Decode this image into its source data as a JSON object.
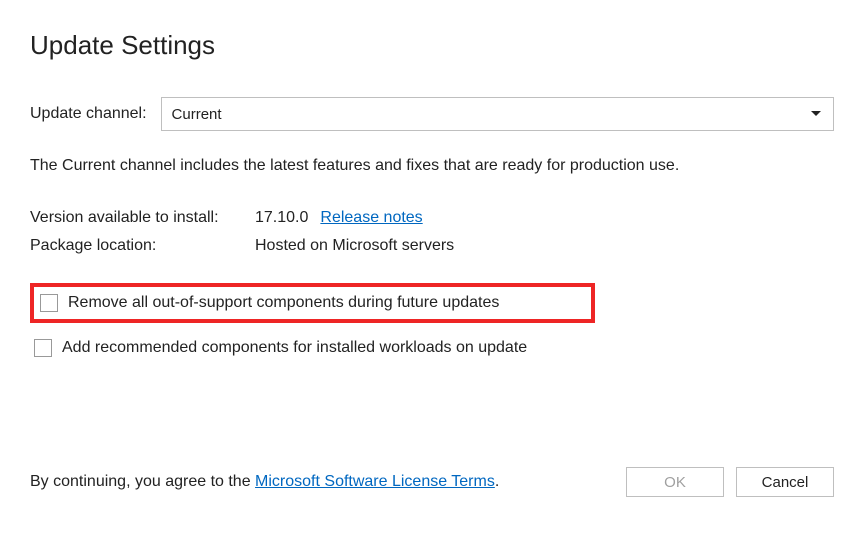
{
  "title": "Update Settings",
  "channel": {
    "label": "Update channel:",
    "selected": "Current",
    "description": "The Current channel includes the latest features and fixes that are ready for production use."
  },
  "version": {
    "label": "Version available to install:",
    "value": "17.10.0",
    "release_notes_link": "Release notes"
  },
  "package": {
    "label": "Package location:",
    "value": "Hosted on Microsoft servers"
  },
  "checkboxes": {
    "remove_components": "Remove all out-of-support components during future updates",
    "add_recommended": "Add recommended components for installed workloads on update"
  },
  "footer": {
    "prefix": "By continuing, you agree to the ",
    "link": "Microsoft Software License Terms",
    "suffix": ".",
    "ok": "OK",
    "cancel": "Cancel"
  }
}
